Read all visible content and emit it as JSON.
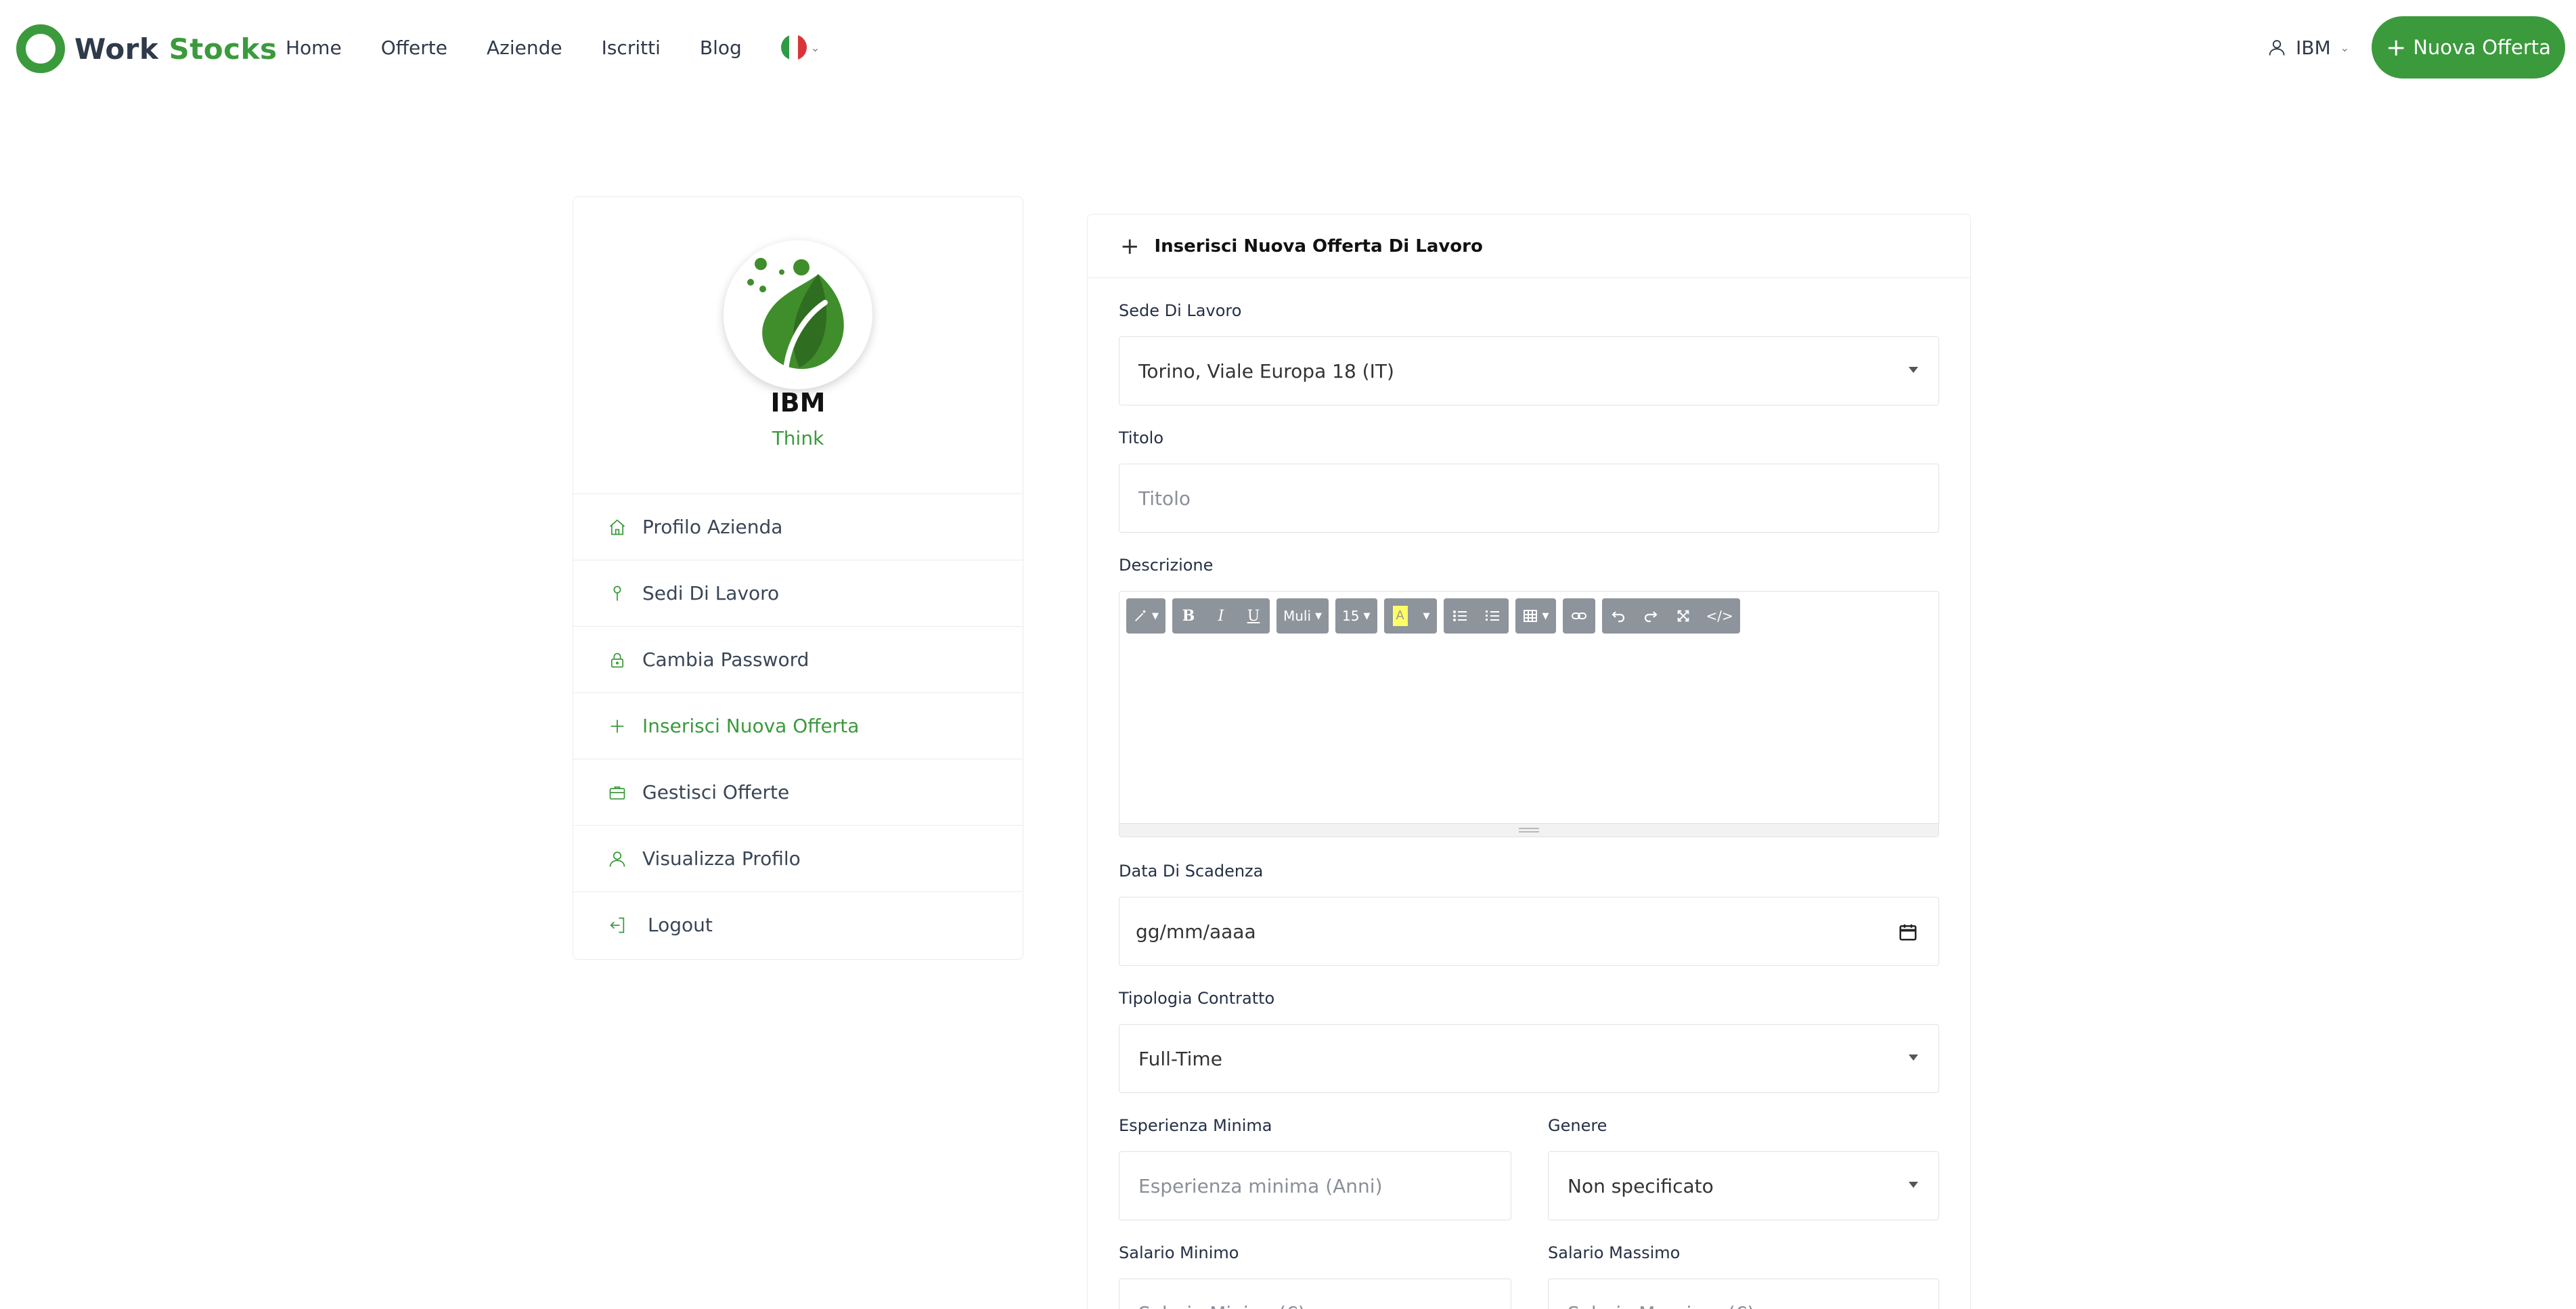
{
  "brand": {
    "word1": "Work",
    "word2": "Stocks"
  },
  "nav": {
    "items": [
      "Home",
      "Offerte",
      "Aziende",
      "Iscritti",
      "Blog"
    ]
  },
  "user_menu": {
    "label": "IBM"
  },
  "cta": {
    "label": "Nuova Offerta"
  },
  "profile": {
    "name": "IBM",
    "tagline": "Think"
  },
  "sidebar": {
    "items": [
      {
        "label": "Profilo Azienda",
        "icon": "home-icon"
      },
      {
        "label": "Sedi Di Lavoro",
        "icon": "location-pin-icon"
      },
      {
        "label": "Cambia Password",
        "icon": "lock-icon"
      },
      {
        "label": "Inserisci Nuova Offerta",
        "icon": "plus-icon",
        "active": true
      },
      {
        "label": "Gestisci Offerte",
        "icon": "briefcase-icon"
      },
      {
        "label": "Visualizza Profilo",
        "icon": "user-icon"
      },
      {
        "label": "Logout",
        "icon": "logout-icon"
      }
    ]
  },
  "form": {
    "title": "Inserisci Nuova Offerta Di Lavoro",
    "sede": {
      "label": "Sede Di Lavoro",
      "value": "Torino, Viale Europa 18 (IT)"
    },
    "titolo": {
      "label": "Titolo",
      "placeholder": "Titolo"
    },
    "descrizione": {
      "label": "Descrizione"
    },
    "scadenza": {
      "label": "Data Di Scadenza",
      "placeholder": "gg/mm/aaaa"
    },
    "contratto": {
      "label": "Tipologia Contratto",
      "value": "Full-Time"
    },
    "esperienza": {
      "label": "Esperienza Minima",
      "placeholder": "Esperienza minima (Anni)"
    },
    "genere": {
      "label": "Genere",
      "value": "Non specificato"
    },
    "salario_min": {
      "label": "Salario Minimo",
      "placeholder": "Salario Minimo(€)"
    },
    "salario_max": {
      "label": "Salario Massimo",
      "placeholder": "Salario Massimo (€)"
    }
  },
  "editor_toolbar": {
    "font": "Muli",
    "size": "15"
  },
  "colors": {
    "accent": "#3b9a3c",
    "text": "#2f3a4a",
    "toolbar": "#8e949c"
  }
}
